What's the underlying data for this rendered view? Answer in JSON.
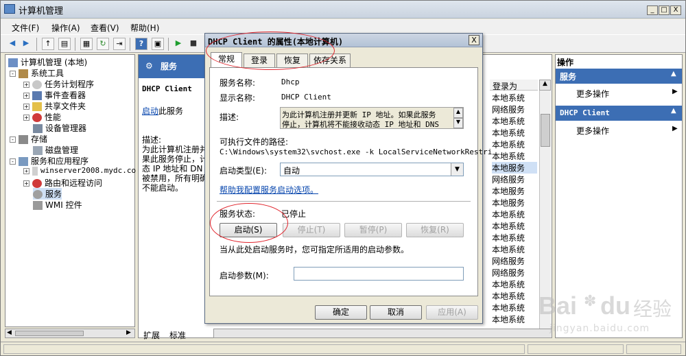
{
  "window": {
    "title": "计算机管理",
    "controls": [
      "_",
      "□",
      "X"
    ]
  },
  "menu": [
    "文件(F)",
    "操作(A)",
    "查看(V)",
    "帮助(H)"
  ],
  "toolbar": {
    "icons": [
      "back-icon",
      "forward-icon",
      "up-folder-icon",
      "console-tree-icon",
      "properties-icon",
      "refresh-icon",
      "export-icon",
      "help-icon",
      "view-icon",
      "play-icon",
      "stop-icon"
    ]
  },
  "tree": [
    {
      "label": "计算机管理 (本地)",
      "level": 0,
      "expander": ""
    },
    {
      "label": "系统工具",
      "level": 1,
      "expander": "-"
    },
    {
      "label": "任务计划程序",
      "level": 2,
      "expander": "+"
    },
    {
      "label": "事件查看器",
      "level": 2,
      "expander": "+"
    },
    {
      "label": "共享文件夹",
      "level": 2,
      "expander": "+"
    },
    {
      "label": "性能",
      "level": 2,
      "expander": "+"
    },
    {
      "label": "设备管理器",
      "level": 2,
      "expander": ""
    },
    {
      "label": "存储",
      "level": 1,
      "expander": "-"
    },
    {
      "label": "磁盘管理",
      "level": 2,
      "expander": ""
    },
    {
      "label": "服务和应用程序",
      "level": 1,
      "expander": "-"
    },
    {
      "label": "winserver2008.mydc.co",
      "level": 2,
      "expander": "+"
    },
    {
      "label": "路由和远程访问",
      "level": 2,
      "expander": "+"
    },
    {
      "label": "服务",
      "level": 2,
      "expander": ""
    },
    {
      "label": "WMI 控件",
      "level": 2,
      "expander": ""
    }
  ],
  "services_panel": {
    "header": "服务",
    "service_name": "DHCP Client",
    "start_link": "启动",
    "start_suffix": "此服务",
    "desc_label": "描述:",
    "desc_lines": [
      "为此计算机注册并",
      "果此服务停止，计",
      "态 IP 地址和 DN",
      "被禁用，所有明确",
      "不能启动。"
    ],
    "tabs": [
      "扩展",
      "标准"
    ]
  },
  "logon_column": {
    "header": "登录为",
    "rows": [
      "本地系统",
      "网络服务",
      "本地系统",
      "本地系统",
      "本地系统",
      "本地系统",
      "本地服务",
      "网络服务",
      "本地服务",
      "本地服务",
      "本地系统",
      "本地系统",
      "本地系统",
      "本地系统",
      "网络服务",
      "网络服务",
      "本地系统",
      "本地系统",
      "本地系统",
      "本地系统"
    ]
  },
  "actions": {
    "header": "操作",
    "section1": "服务",
    "item1": "更多操作",
    "section2": "DHCP Client",
    "item2": "更多操作"
  },
  "dialog": {
    "title": "DHCP Client 的属性(本地计算机)",
    "close": "X",
    "tabs": [
      "常规",
      "登录",
      "恢复",
      "依存关系"
    ],
    "service_name_label": "服务名称:",
    "service_name": "Dhcp",
    "display_name_label": "显示名称:",
    "display_name": "DHCP Client",
    "desc_label": "描述:",
    "desc_text_1": "为此计算机注册并更新 IP 地址。如果此服务",
    "desc_text_2": "停止，计算机将不能接收动态 IP 地址和 DNS",
    "path_label": "可执行文件的路径:",
    "path": "C:\\Windows\\system32\\svchost.exe -k LocalServiceNetworkRestri",
    "startup_type_label": "启动类型(E):",
    "startup_type": "自动",
    "help_link": "帮助我配置服务启动选项。",
    "status_label": "服务状态:",
    "status": "已停止",
    "btn_start": "启动(S)",
    "btn_stop": "停止(T)",
    "btn_pause": "暂停(P)",
    "btn_resume": "恢复(R)",
    "hint": "当从此处启动服务时，您可指定所适用的启动参数。",
    "params_label": "启动参数(M):",
    "params_value": "",
    "ok": "确定",
    "cancel": "取消",
    "apply": "应用(A)"
  },
  "watermark": {
    "brand": "Bai",
    "paw": "du",
    "cn": "经验",
    "url": "jingyan.baidu.com"
  }
}
